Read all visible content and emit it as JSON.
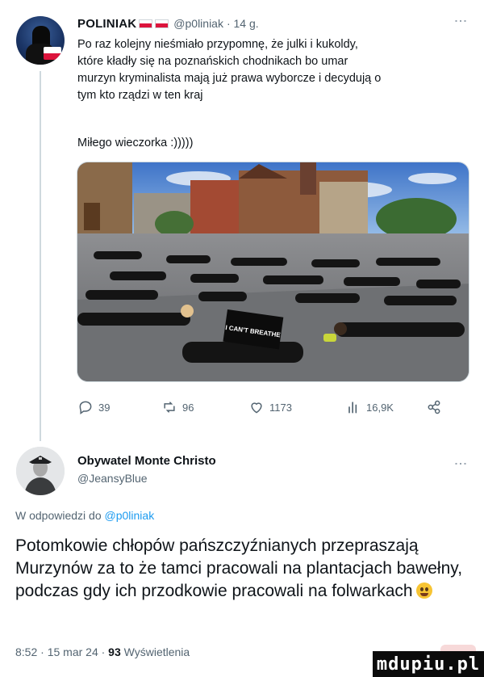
{
  "tweet": {
    "author_name": "POLINIAK",
    "handle": "@p0liniak",
    "time": "· 14 g.",
    "text": "Po raz kolejny nieśmiało przypomnę, że julki i kukoldy,\nktóre kładły się na poznańskich chodnikach bo umar\nmurzyn kryminalista mają już prawa wyborcze i decydują o\ntym kto rządzi w ten kraj",
    "text2": "Miłego wieczorka :)))))",
    "photo_sign_text": "I CAN'T BREATHE",
    "stats": {
      "replies": "39",
      "retweets": "96",
      "likes": "1173",
      "views": "16,9K"
    }
  },
  "reply": {
    "author_name": "Obywatel Monte Christo",
    "handle": "@JeansyBlue",
    "reply_prefix": "W odpowiedzi do ",
    "reply_to": "@p0liniak",
    "text": "Potomkowie chłopów pańszczyźnianych przepraszają Murzynów za to że tamci pracowali na plantacjach bawełny, podczas gdy ich przodkowie pracowali na folwarkach",
    "time": "8:52 · 15 mar 24 · ",
    "views_count": "93",
    "views_label": "Wyświetlenia"
  },
  "watermark": "mdupiu.pl",
  "colors": {
    "accent": "#1d9bf0",
    "text": "#0f1419",
    "muted": "#536471",
    "flag_white": "#ffffff",
    "flag_red": "#dc143c"
  },
  "icons": [
    "reply-icon",
    "retweet-icon",
    "like-icon",
    "views-icon",
    "share-icon",
    "more-icon"
  ]
}
